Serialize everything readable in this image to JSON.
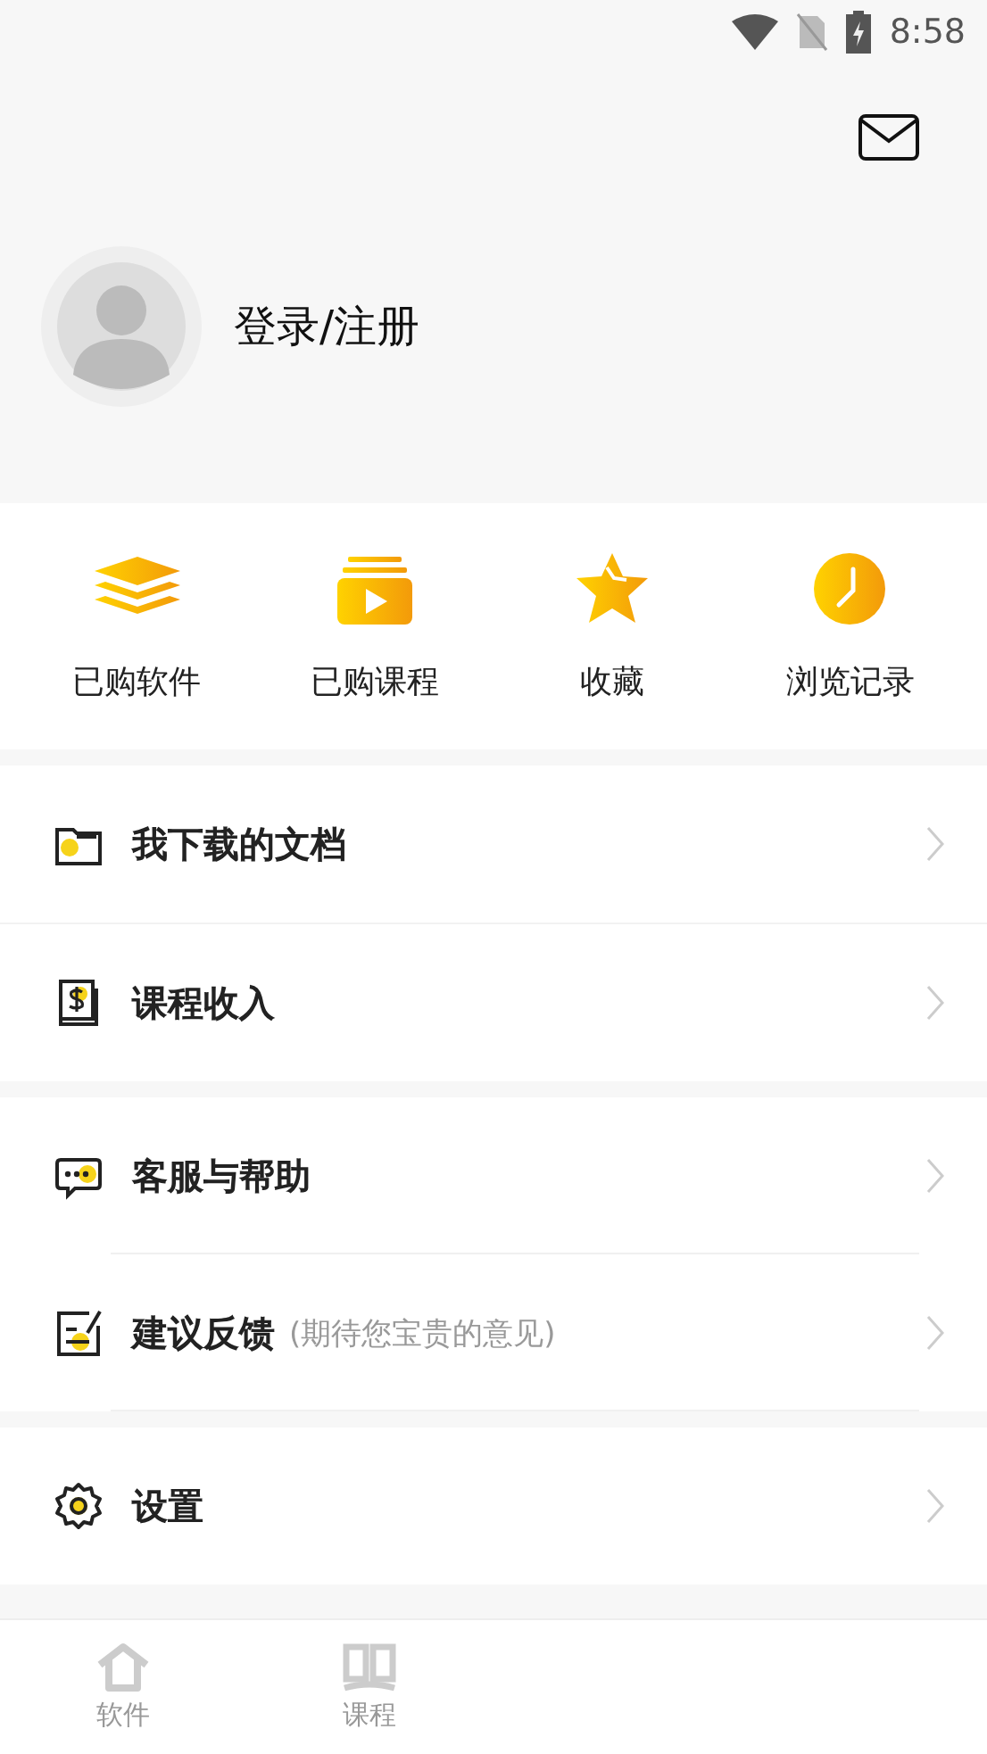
{
  "status_bar": {
    "time": "8:58"
  },
  "profile": {
    "login_label": "登录/注册"
  },
  "shortcuts": [
    {
      "kind": "layers",
      "label": "已购软件"
    },
    {
      "kind": "video",
      "label": "已购课程"
    },
    {
      "kind": "star",
      "label": "收藏"
    },
    {
      "kind": "clock",
      "label": "浏览记录"
    }
  ],
  "menu_groups": [
    {
      "items": [
        {
          "kind": "folder",
          "label": "我下载的文档"
        },
        {
          "kind": "income",
          "label": "课程收入"
        }
      ]
    },
    {
      "items": [
        {
          "kind": "chat",
          "label": "客服与帮助"
        },
        {
          "kind": "feedback",
          "label": "建议反馈",
          "note": "(期待您宝贵的意见)"
        }
      ]
    },
    {
      "items": [
        {
          "kind": "settings",
          "label": "设置"
        }
      ]
    }
  ],
  "bottom_nav": [
    {
      "kind": "home",
      "label": "软件"
    },
    {
      "kind": "book",
      "label": "课程"
    }
  ]
}
